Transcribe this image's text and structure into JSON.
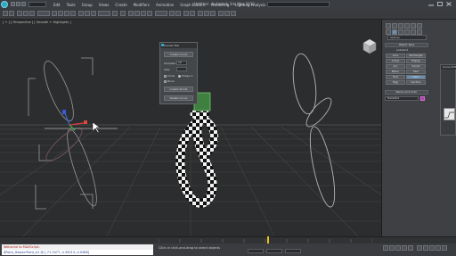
{
  "title_bar": {
    "app_title": "Untitled - Autodesk 3ds Max 2012",
    "menu": [
      "Edit",
      "Tools",
      "Group",
      "Views",
      "Create",
      "Modifiers",
      "Animation",
      "Graph Editors",
      "Rendering",
      "Lighting Analysis",
      "Customize",
      "MAXScript",
      "Help"
    ],
    "window_controls": [
      "minimize",
      "maximize",
      "close"
    ]
  },
  "viewport": {
    "label": "[ + ] [ Perspective ] [ Smooth + Highlights ]",
    "viewcube": "home-icon"
  },
  "dialog": {
    "title": "Curves Tool",
    "button_top": "Create Curve",
    "spinner_label": "Samples:",
    "spinner_value": "10",
    "check_label": "Size:",
    "radio_1": "Cross",
    "radio_2": "Shape A",
    "radio_3": "Bone",
    "button_mid": "Create Points",
    "button_bottom": "Delete Curve"
  },
  "command_panel": {
    "dropdown": "Splines",
    "object_type_header": "Object Type",
    "autogrid_label": "AutoGrid",
    "buttons": [
      "Line",
      "Rectangle",
      "Circle",
      "Ellipse",
      "Arc",
      "Donut",
      "NGon",
      "Star",
      "Text",
      "Helix",
      "Egg",
      "Section"
    ],
    "name_color_header": "Name and Color",
    "object_name": "Helix001"
  },
  "panel2": {
    "title": "Curve Editor"
  },
  "timeline": {
    "current_frame": "50",
    "start": "0",
    "end": "100"
  },
  "status": {
    "maxscript_line1": "Welcome to MAXScript.",
    "maxscript_line2": "$Point_Helper:Point_A1 @ [-71.3477,-4.35013,-0.0388]",
    "prompt": "Click or click-and-drag to select objects",
    "add_time_tag": "Add Time Tag"
  },
  "colors": {
    "accent": "#2ea8c4",
    "selection_magenta": "#b43fb0",
    "time_slider": "#e2c21f"
  }
}
